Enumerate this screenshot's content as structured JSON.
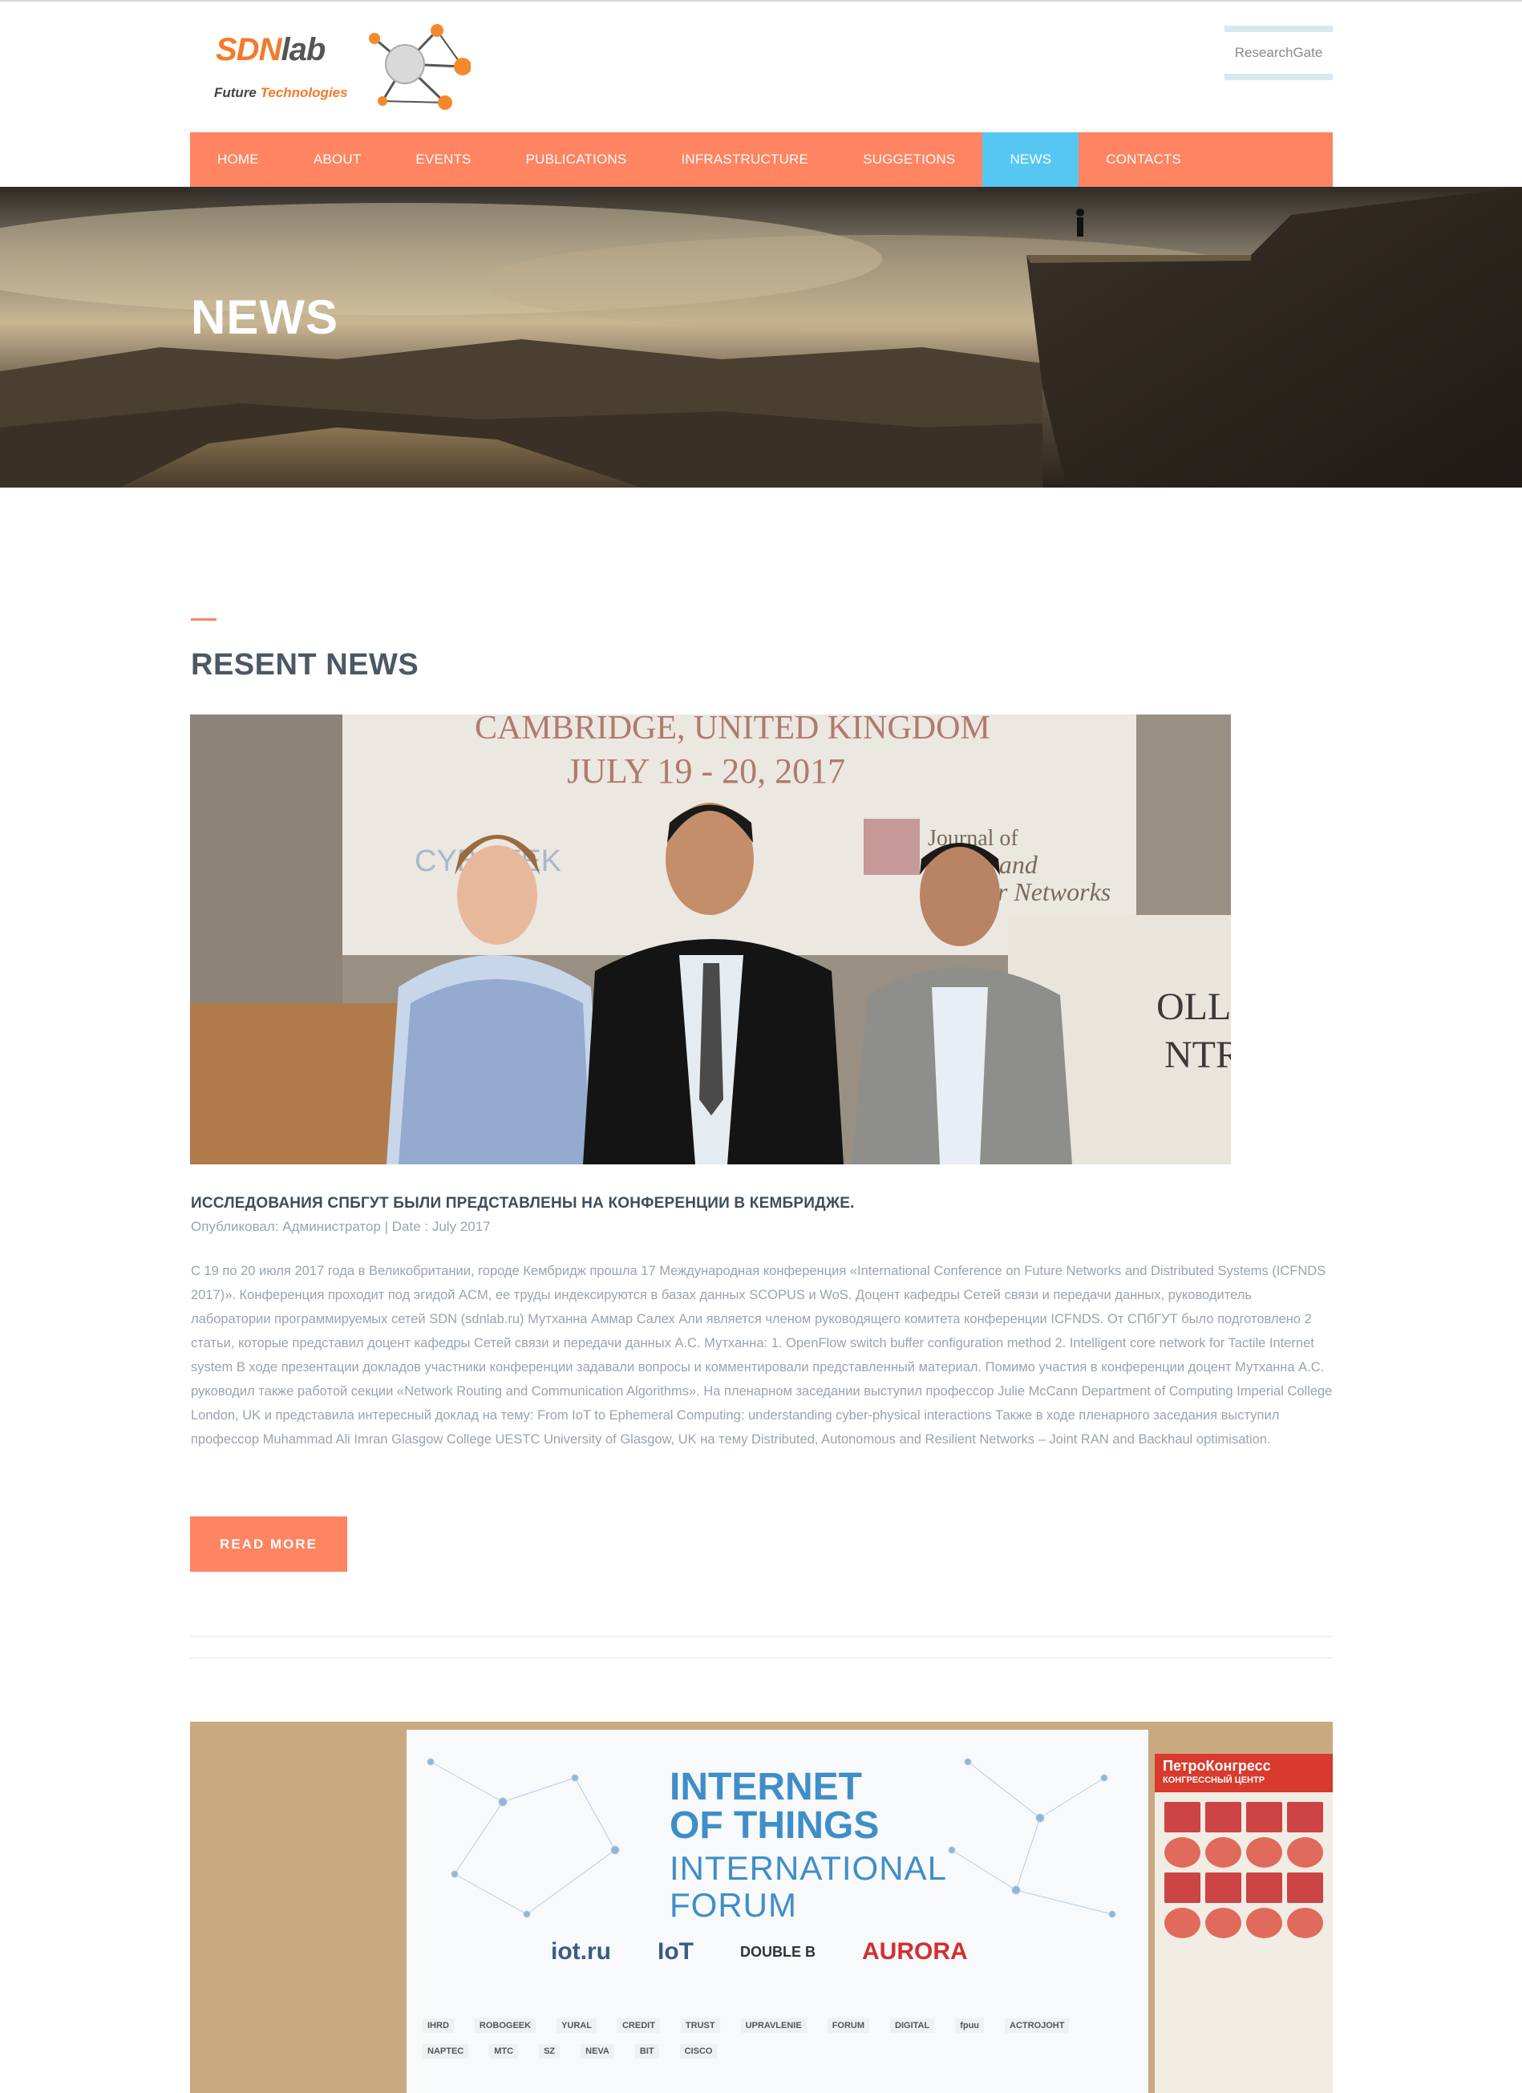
{
  "header": {
    "logo_main": "SDN",
    "logo_lab": "lab",
    "logo_sub_1": "Future",
    "logo_sub_2": "Technologies",
    "researchgate": "ResearchGate"
  },
  "nav": {
    "items": [
      "HOME",
      "ABOUT",
      "EVENTS",
      "PUBLICATIONS",
      "INFRASTRUCTURE",
      "SUGGETIONS",
      "NEWS",
      "CONTACTS"
    ],
    "active": "NEWS"
  },
  "hero": {
    "title": "NEWS"
  },
  "section": {
    "title": "RESENT NEWS"
  },
  "photo1": {
    "line1": "CAMBRIDGE, UNITED KINGDOM",
    "line2": "JULY 19 - 20, 2017",
    "logo_left": "CYB  ATEK",
    "journal": "Journal of",
    "journal2": "sor and",
    "journal3": "uator Networks",
    "board": "OLLER",
    "board2": "NTRE"
  },
  "post": {
    "title": "ИССЛЕДОВАНИЯ СПБГУТ БЫЛИ ПРЕДСТАВЛЕНЫ НА КОНФЕРЕНЦИИ В КЕМБРИДЖЕ.",
    "meta": "Опубликовал: Администратор | Date : July 2017",
    "body": "С 19 по 20 июля 2017 года в Великобритании, городе Кембридж прошла 17 Международная конференция «International Conference on Future Networks and Distributed Systems (ICFNDS 2017)». Конференция проходит под эгидой ACM, ее труды индексируются в базах данных SCOPUS и WoS. Доцент кафедры Сетей связи и передачи данных, руководитель лаборатории программируемых сетей SDN (sdnlab.ru) Мутханна Аммар Салех Али является членом руководящего комитета конференции ICFNDS. От СПбГУТ было подготовлено 2 статьи, которые представил доцент кафедры Сетей связи и передачи данных А.С. Мутханна: 1. OpenFlow switch buffer configuration method 2. Intelligent core network for Tactile Internet system В ходе презентации докладов участники конференции задавали вопросы и комментировали представленный материал. Помимо участия в конференции доцент Мутханна А.С. руководил также работой секции «Network Routing and Communication Algorithms». На пленарном заседании выступил профессор Julie McCann Department of Computing Imperial College London, UK и представила интересный доклад на тему: From IoT to Ephemeral Computing: understanding cyber-physical interactions Также в ходе пленарного заседания выступил профессор Muhammad Ali Imran Glasgow College UESTC University of Glasgow, UK на тему Distributed, Autonomous and Resilient Networks – Joint RAN and Backhaul optimisation.",
    "read_more": "READ MORE"
  },
  "photo2": {
    "line1": "INTERNET",
    "line2": "OF THINGS",
    "line3": "INTERNATIONAL",
    "line4": "FORUM",
    "logo1": "iot.ru",
    "logo2": "IoT",
    "logo3": "DOUBLE B",
    "logo4": "AURORA",
    "poster_head": "ПетроКонгресс",
    "poster_sub": "КОНГРЕССНЫЙ ЦЕНТР",
    "sponsors": [
      "IHRD",
      "ROBOGEEK",
      "YURAL",
      "CREDIT",
      "TRUST",
      "UPRAVLENIE",
      "FORUM",
      "DIGITAL",
      "fpuu",
      "ACTROJOHT",
      "NAPTEC",
      "MTC",
      "SZ",
      "NEVA",
      "BIT",
      "CISCO"
    ]
  }
}
